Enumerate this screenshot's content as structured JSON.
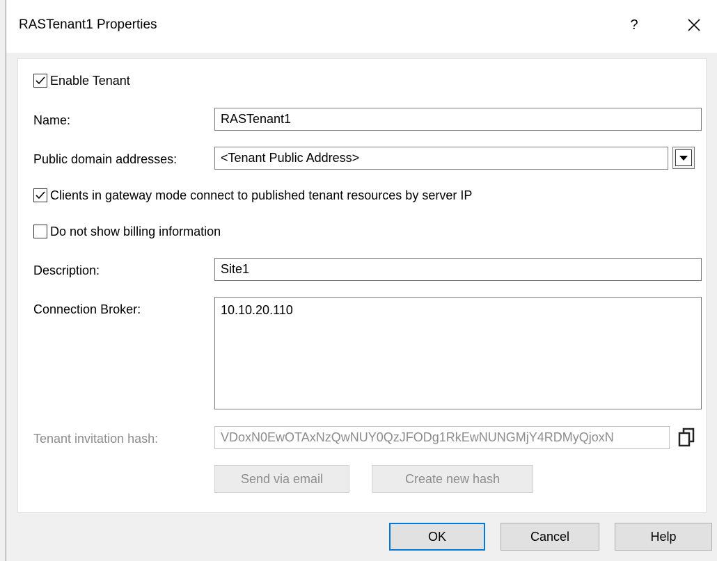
{
  "window": {
    "title": "RASTenant1 Properties",
    "help_glyph": "?",
    "close_icon": "close-icon"
  },
  "form": {
    "enable_tenant": {
      "label": "Enable Tenant",
      "checked": true
    },
    "name": {
      "label": "Name:",
      "value": "RASTenant1"
    },
    "public_domain": {
      "label": "Public domain addresses:",
      "value": "<Tenant Public Address>"
    },
    "gateway_mode": {
      "label": "Clients in gateway mode connect to published tenant resources by server IP",
      "checked": true
    },
    "billing": {
      "label": "Do not show billing information",
      "checked": false
    },
    "description": {
      "label": "Description:",
      "value": "Site1"
    },
    "connection_broker": {
      "label": "Connection Broker:",
      "value": "10.10.20.110"
    },
    "invitation_hash": {
      "label": "Tenant invitation hash:",
      "value": "VDoxN0EwOTAxNzQwNUY0QzJFODg1RkEwNUNGMjY4RDMyQjoxN"
    },
    "send_email_label": "Send via email",
    "create_hash_label": "Create new hash"
  },
  "footer": {
    "ok_label": "OK",
    "cancel_label": "Cancel",
    "help_label": "Help"
  },
  "colors": {
    "default_button_border": "#0078d7",
    "disabled_text": "#8c8c8c"
  },
  "icons": {
    "copy": "copy-icon",
    "dropdown": "dropdown-arrow-icon",
    "check": "checkmark-icon"
  }
}
